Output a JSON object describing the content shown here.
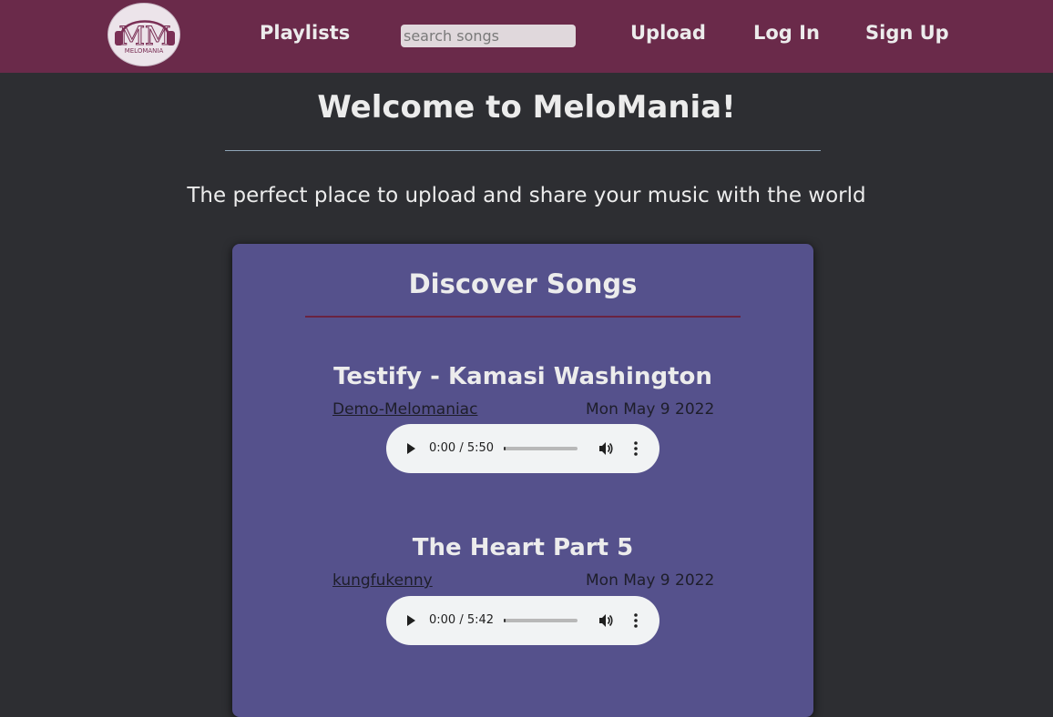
{
  "header": {
    "logo_text": "MELOMANIA",
    "logo_letters": "MM",
    "nav": {
      "playlists": "Playlists",
      "upload": "Upload",
      "login": "Log In",
      "signup": "Sign Up"
    },
    "search": {
      "placeholder": "search songs",
      "value": ""
    }
  },
  "hero": {
    "title": "Welcome to MeloMania!",
    "tagline": "The perfect place to upload and share your music with the world"
  },
  "discover": {
    "title": "Discover Songs",
    "songs": [
      {
        "title": "Testify - Kamasi Washington",
        "uploader": "Demo-Melomaniac",
        "date": "Mon May 9 2022",
        "time": "0:00 / 5:50",
        "progress": 0
      },
      {
        "title": "The Heart Part 5",
        "uploader": "kungfukenny",
        "date": "Mon May 9 2022",
        "time": "0:00 / 5:42",
        "progress": 0
      }
    ]
  },
  "colors": {
    "nav_bg": "#6a2a4a",
    "page_bg": "#2d2e32",
    "card_bg": "#55518c",
    "player_bg": "#f1f3f4"
  },
  "icons": {
    "play": "play-icon",
    "volume": "volume-icon",
    "more": "more-vertical-icon",
    "logo": "headphones-logo-icon"
  }
}
